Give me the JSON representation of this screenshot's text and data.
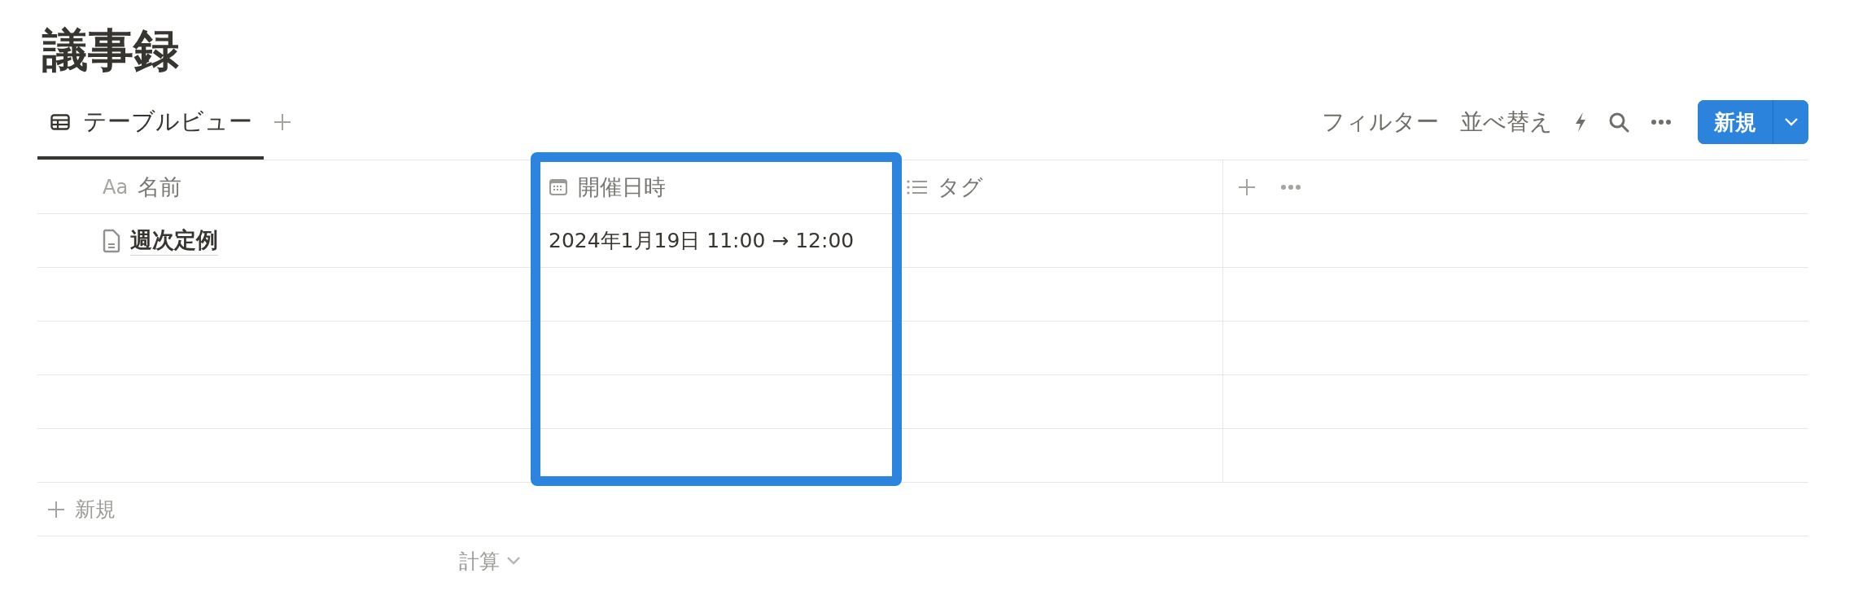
{
  "page_title": "議事録",
  "views": [
    {
      "label": "テーブルビュー",
      "selected": true
    }
  ],
  "toolbar": {
    "actions": [
      "フィルター",
      "並べ替え"
    ],
    "new_button": "新規"
  },
  "table": {
    "columns": [
      {
        "kind": "title",
        "icon_text": "Aa",
        "label": "名前",
        "highlighted": false
      },
      {
        "kind": "date",
        "label": "開催日時",
        "highlighted": true
      },
      {
        "kind": "multi_select",
        "label": "タグ",
        "highlighted": false
      }
    ],
    "rows": [
      {
        "title": "週次定例",
        "date": "2024年1月19日 11:00 → 12:00"
      },
      {},
      {},
      {},
      {}
    ],
    "new_row": "新規",
    "calculate": "計算"
  }
}
